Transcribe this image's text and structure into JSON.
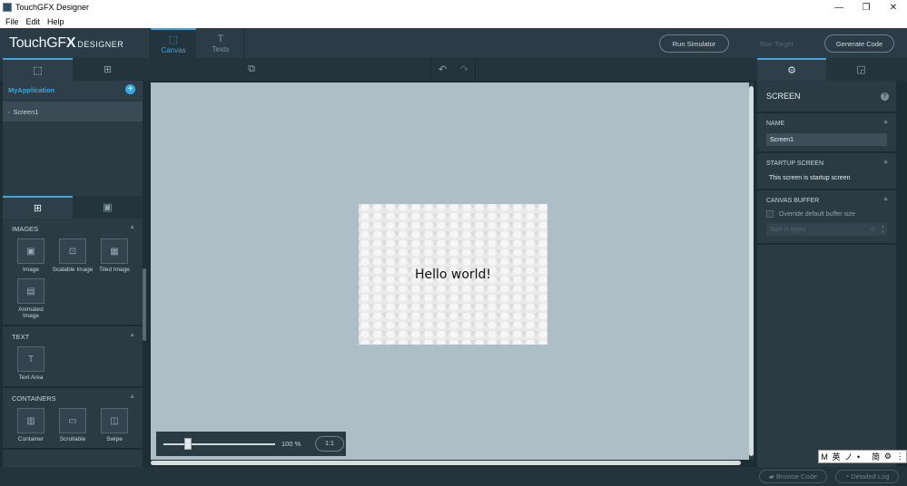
{
  "window": {
    "title": "TouchGFX Designer",
    "controls": [
      "—",
      "❐",
      "✕"
    ]
  },
  "menu": [
    "File",
    "Edit",
    "Help"
  ],
  "logo": {
    "main": "TouchGF",
    "x": "X",
    "sub": "DESIGNER"
  },
  "tabs": [
    {
      "label": "Canvas",
      "icon": "⬚"
    },
    {
      "label": "Texts",
      "icon": "T"
    }
  ],
  "toolbar": {
    "run_simulator": "Run Simulator",
    "run_target": "Run Target",
    "generate_code": "Generate Code"
  },
  "tree": {
    "app_name": "MyApplication",
    "add": "+",
    "items": [
      {
        "label": "Screen1"
      }
    ]
  },
  "widget_sections": [
    {
      "title": "IMAGES",
      "items": [
        {
          "label": "Image",
          "icon": "▣"
        },
        {
          "label": "Scalable Image",
          "icon": "⊡"
        },
        {
          "label": "Tiled Image",
          "icon": "▦"
        },
        {
          "label": "Animated Image",
          "icon": "▤"
        }
      ]
    },
    {
      "title": "TEXT",
      "items": [
        {
          "label": "Text Area",
          "icon": "T"
        }
      ]
    },
    {
      "title": "CONTAINERS",
      "items": [
        {
          "label": "Container",
          "icon": "▥"
        },
        {
          "label": "Scrollable",
          "icon": "▭"
        },
        {
          "label": "Swipe",
          "icon": "◫"
        }
      ]
    }
  ],
  "canvas": {
    "text": "Hello world!",
    "zoom": 100,
    "zoom_label": "100 %",
    "reset": "1:1"
  },
  "properties": {
    "header": "SCREEN",
    "help": "?",
    "name_label": "NAME",
    "name_value": "Screen1",
    "startup_label": "STARTUP SCREEN",
    "startup_text": "This screen is startup screen",
    "buffer_label": "CANVAS BUFFER",
    "override_label": "Override default buffer size",
    "size_placeholder": "Size in bytes",
    "size_value": "0"
  },
  "status": {
    "browse_code": "Browse Code",
    "detailed_log": "Detailed Log"
  },
  "ime": [
    "M",
    "英",
    "ノ",
    "•ㅤ",
    "简",
    "⚙",
    "⋮"
  ],
  "colors": {
    "accent": "#3fa6dd",
    "canvas_bg": "#adbec6",
    "panel": "#2b3b44"
  }
}
